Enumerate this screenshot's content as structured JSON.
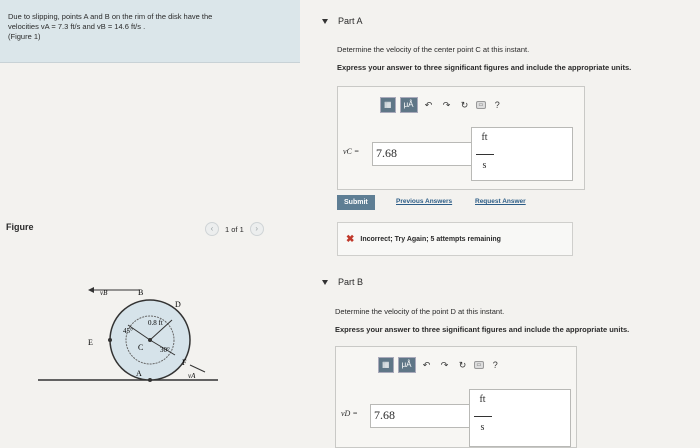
{
  "problem": {
    "line1": "Due to slipping, points A and B on the rim of the disk have the",
    "line2": "velocities vA = 7.3 ft/s and vB = 14.6 ft/s .",
    "line3": "(Figure 1)"
  },
  "figure": {
    "label": "Figure",
    "pager_text": "1 of 1",
    "labels": {
      "vB": "vB",
      "B": "B",
      "D": "D",
      "dist": "0.8 ft",
      "angle45": "45°",
      "angle30": "30°",
      "E": "E",
      "C": "C",
      "F": "F",
      "A": "A",
      "vA": "vA"
    }
  },
  "partA": {
    "title": "Part A",
    "question": "Determine the velocity of the center point C at this instant.",
    "instruction": "Express your answer to three significant figures and include the appropriate units.",
    "var_label": "vC =",
    "value": "7.68",
    "unit_num": "ft",
    "unit_den": "s",
    "submit": "Submit",
    "prev_answers": "Previous Answers",
    "request_answer": "Request Answer",
    "feedback": "Incorrect; Try Again; 5 attempts remaining"
  },
  "partB": {
    "title": "Part B",
    "question": "Determine the velocity of the point D at this instant.",
    "instruction": "Express your answer to three significant figures and include the appropriate units.",
    "var_label": "vD =",
    "value": "7.68",
    "unit_num": "ft",
    "unit_den": "s"
  },
  "toolbar": {
    "mu": "μÅ",
    "help": "?"
  }
}
